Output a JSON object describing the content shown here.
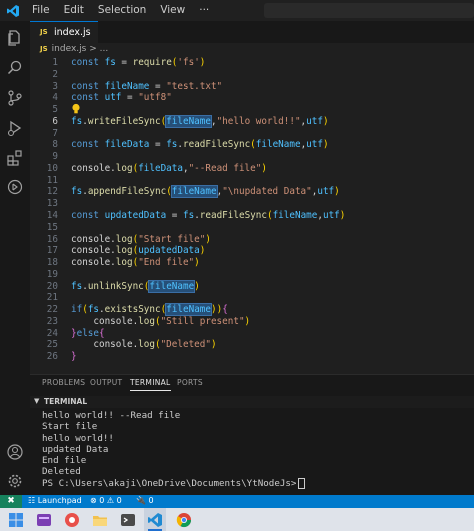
{
  "menu": [
    "File",
    "Edit",
    "Selection",
    "View",
    "···"
  ],
  "tab": {
    "label": "index.js",
    "lang_badge": "JS"
  },
  "breadcrumb": {
    "lang_badge": "JS",
    "file": "index.js",
    "sep": ">",
    "rest": "..."
  },
  "code": {
    "line_numbers": [
      "1",
      "2",
      "3",
      "4",
      "5",
      "6",
      "7",
      "8",
      "9",
      "10",
      "11",
      "12",
      "13",
      "14",
      "15",
      "16",
      "17",
      "18",
      "19",
      "20",
      "21",
      "22",
      "23",
      "24",
      "25",
      "26"
    ],
    "active_line": "6",
    "lines": [
      "const fs = require('fs')",
      "",
      "const fileName = \"test.txt\"",
      "const utf = \"utf8\"",
      "",
      "fs.writeFileSync(fileName,\"hello world!!\",utf)",
      "",
      "const fileData = fs.readFileSync(fileName,utf)",
      "",
      "console.log(fileData,\"--Read file\")",
      "",
      "fs.appendFileSync(fileName,\"\\nupdated Data\",utf)",
      "",
      "const updatedData = fs.readFileSync(fileName,utf)",
      "",
      "console.log(\"Start file\")",
      "console.log(updatedData)",
      "console.log(\"End file\")",
      "",
      "fs.unlinkSync(fileName)",
      "",
      "if(fs.existsSync(fileName)){",
      "    console.log(\"Still present\")",
      "}else{",
      "    console.log(\"Deleted\")",
      "}"
    ]
  },
  "panel": {
    "tabs": [
      "PROBLEMS",
      "OUTPUT",
      "TERMINAL",
      "PORTS"
    ],
    "active_tab": "TERMINAL",
    "section_title": "TERMINAL",
    "terminal_lines": [
      "hello world!! --Read file",
      "Start file",
      "hello world!!",
      "updated Data",
      "End file",
      "Deleted",
      "PS C:\\Users\\akaji\\OneDrive\\Documents\\YtNodeJs>"
    ]
  },
  "status": {
    "remote": "✖",
    "launchpad": "Launchpad",
    "errors": "0",
    "warnings": "0",
    "ports": "0"
  },
  "colors": {
    "accent": "#007acc",
    "keyword": "#569cd6",
    "string": "#ce9178",
    "function": "#dcdcaa",
    "variable": "#9cdcfe",
    "highlight": "#264f78"
  }
}
